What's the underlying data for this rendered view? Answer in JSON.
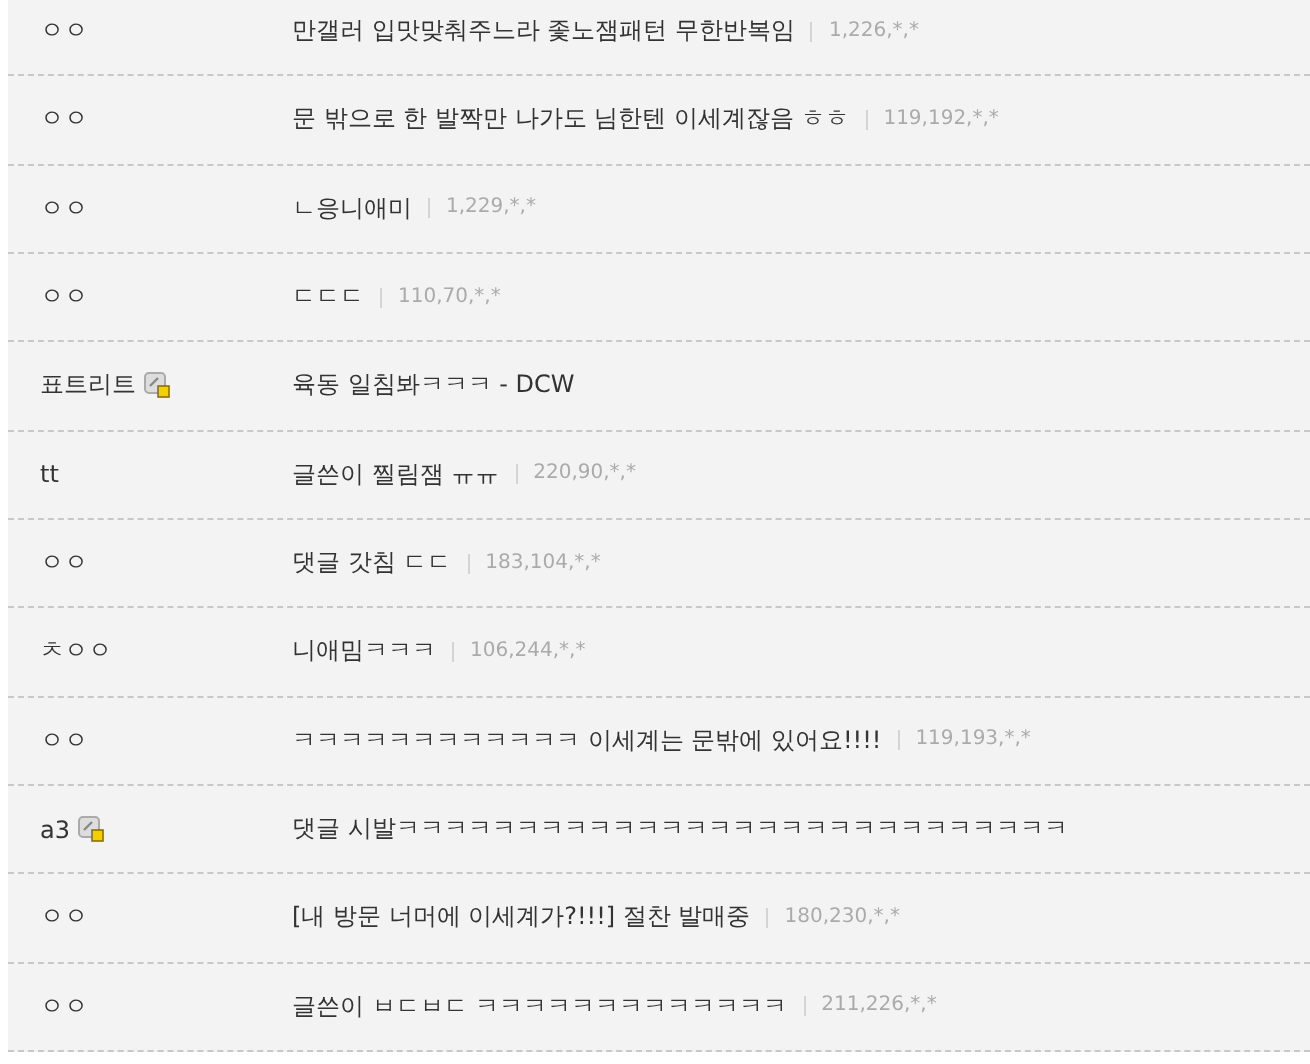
{
  "comments": [
    {
      "name": "ㅇㅇ",
      "member": false,
      "text": "만갤러 입맛맞춰주느라 좇노잼패턴 무한반복임",
      "ip": "1,226,*,*"
    },
    {
      "name": "ㅇㅇ",
      "member": false,
      "text": "문 밖으로 한 발짝만 나가도 님한텐 이세계잖음 ㅎㅎ",
      "ip": "119,192,*,*"
    },
    {
      "name": "ㅇㅇ",
      "member": false,
      "text": "ㄴ응니애미",
      "ip": "1,229,*,*"
    },
    {
      "name": "ㅇㅇ",
      "member": false,
      "text": "ㄷㄷㄷ",
      "ip": "110,70,*,*"
    },
    {
      "name": "표트리트",
      "member": true,
      "text": "육동 일침봐ㅋㅋㅋ - DCW"
    },
    {
      "name": "tt",
      "member": false,
      "text": "글쓴이 찔림잼 ㅠㅠ",
      "ip": "220,90,*,*"
    },
    {
      "name": "ㅇㅇ",
      "member": false,
      "text": "댓글 갓침 ㄷㄷ",
      "ip": "183,104,*,*"
    },
    {
      "name": "ㅊㅇㅇ",
      "member": false,
      "text": "니애밈ㅋㅋㅋ",
      "ip": "106,244,*,*"
    },
    {
      "name": "ㅇㅇ",
      "member": false,
      "text": "ㅋㅋㅋㅋㅋㅋㅋㅋㅋㅋㅋㅋ 이세계는 문밖에 있어요!!!!",
      "ip": "119,193,*,*"
    },
    {
      "name": "a3",
      "member": true,
      "text": "댓글 시발ㅋㅋㅋㅋㅋㅋㅋㅋㅋㅋㅋㅋㅋㅋㅋㅋㅋㅋㅋㅋㅋㅋㅋㅋㅋㅋㅋㅋ"
    },
    {
      "name": "ㅇㅇ",
      "member": false,
      "text": "[내 방문 너머에 이세계가?!!!] 절찬 발매중",
      "ip": "180,230,*,*"
    },
    {
      "name": "ㅇㅇ",
      "member": false,
      "text": "글쓴이 ㅂㄷㅂㄷ ㅋㅋㅋㅋㅋㅋㅋㅋㅋㅋㅋㅋㅋ",
      "ip": "211,226,*,*"
    }
  ]
}
